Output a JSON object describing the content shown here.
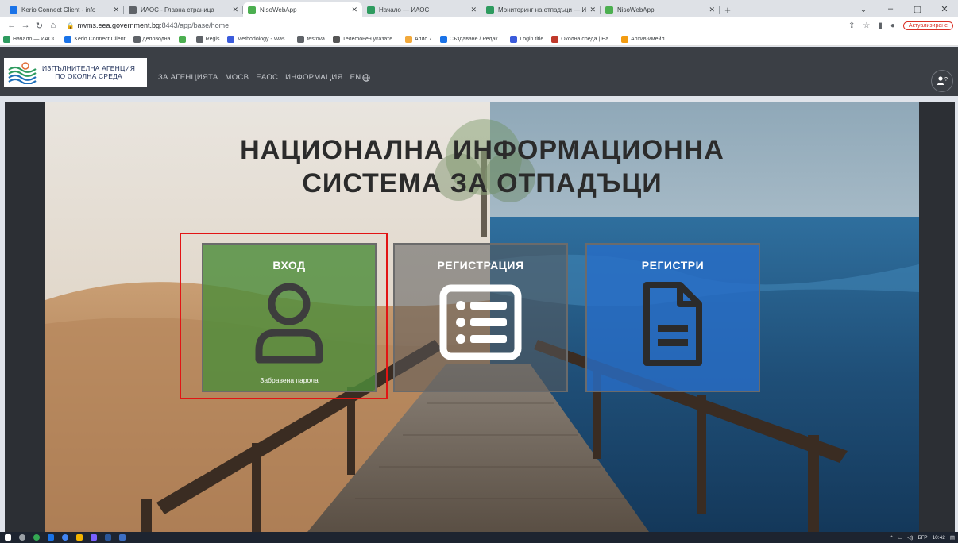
{
  "browser": {
    "tabs": [
      {
        "title": "Kerio Connect Client - info",
        "favicon_color": "#1a73e8",
        "active": false
      },
      {
        "title": "ИАОС - Главна страница",
        "favicon_color": "#5f6368",
        "active": false
      },
      {
        "title": "NisoWebApp",
        "favicon_color": "#4caf50",
        "active": true
      },
      {
        "title": "Начало — ИАОС",
        "favicon_color": "#2e9b5f",
        "active": false
      },
      {
        "title": "Мониторинг на отпадъци — И",
        "favicon_color": "#2e9b5f",
        "active": false
      },
      {
        "title": "NisoWebApp",
        "favicon_color": "#4caf50",
        "active": false
      }
    ],
    "new_tab_label": "+",
    "window_controls": {
      "minimize": "–",
      "maximize": "▢",
      "close": "✕",
      "menu": "⌄"
    },
    "url_host": "nwms.eea.government.bg",
    "url_path": ":8443/app/base/home",
    "update_button": "Актуализиране",
    "bookmarks": [
      {
        "label": "Начало — ИАОС",
        "color": "#2e9b5f"
      },
      {
        "label": "Kerio Connect Client",
        "color": "#1a73e8"
      },
      {
        "label": "деловодна",
        "color": "#5f6368"
      },
      {
        "label": "",
        "color": "#4caf50"
      },
      {
        "label": "Regis",
        "color": "#5f6368"
      },
      {
        "label": "Methodology - Was...",
        "color": "#3b5bdb"
      },
      {
        "label": "testova",
        "color": "#5f6368"
      },
      {
        "label": "Телефонен указате...",
        "color": "#555555"
      },
      {
        "label": "Апис 7",
        "color": "#f2a93b"
      },
      {
        "label": "Създаване / Редак...",
        "color": "#1a73e8"
      },
      {
        "label": "Login title",
        "color": "#3b5bdb"
      },
      {
        "label": "Околна среда | На...",
        "color": "#c0392b"
      },
      {
        "label": "Архив-имейл",
        "color": "#f39c12"
      }
    ]
  },
  "site": {
    "logo_line1": "ИЗПЪЛНИТЕЛНА АГЕНЦИЯ",
    "logo_line2": "ПО ОКОЛНА СРЕДА",
    "nav": [
      "ЗА АГЕНЦИЯТА",
      "МОСВ",
      "ЕАОС",
      "ИНФОРМАЦИЯ"
    ],
    "lang": "EN",
    "help_icon": "user-help-icon"
  },
  "hero": {
    "title_line1": "НАЦИОНАЛНА ИНФОРМАЦИОННА",
    "title_line2": "СИСТЕМА ЗА ОТПАДЪЦИ",
    "cards": {
      "login": {
        "label": "ВХОД",
        "forgot": "Забравена парола",
        "color": "#4e8c3a"
      },
      "registration": {
        "label": "РЕГИСТРАЦИЯ",
        "color": "#5a5a5a"
      },
      "registers": {
        "label": "РЕГИСТРИ",
        "color": "#286ec8"
      }
    },
    "highlight_color": "#e21414"
  },
  "taskbar": {
    "lang": "БГР",
    "time": "10:42"
  }
}
